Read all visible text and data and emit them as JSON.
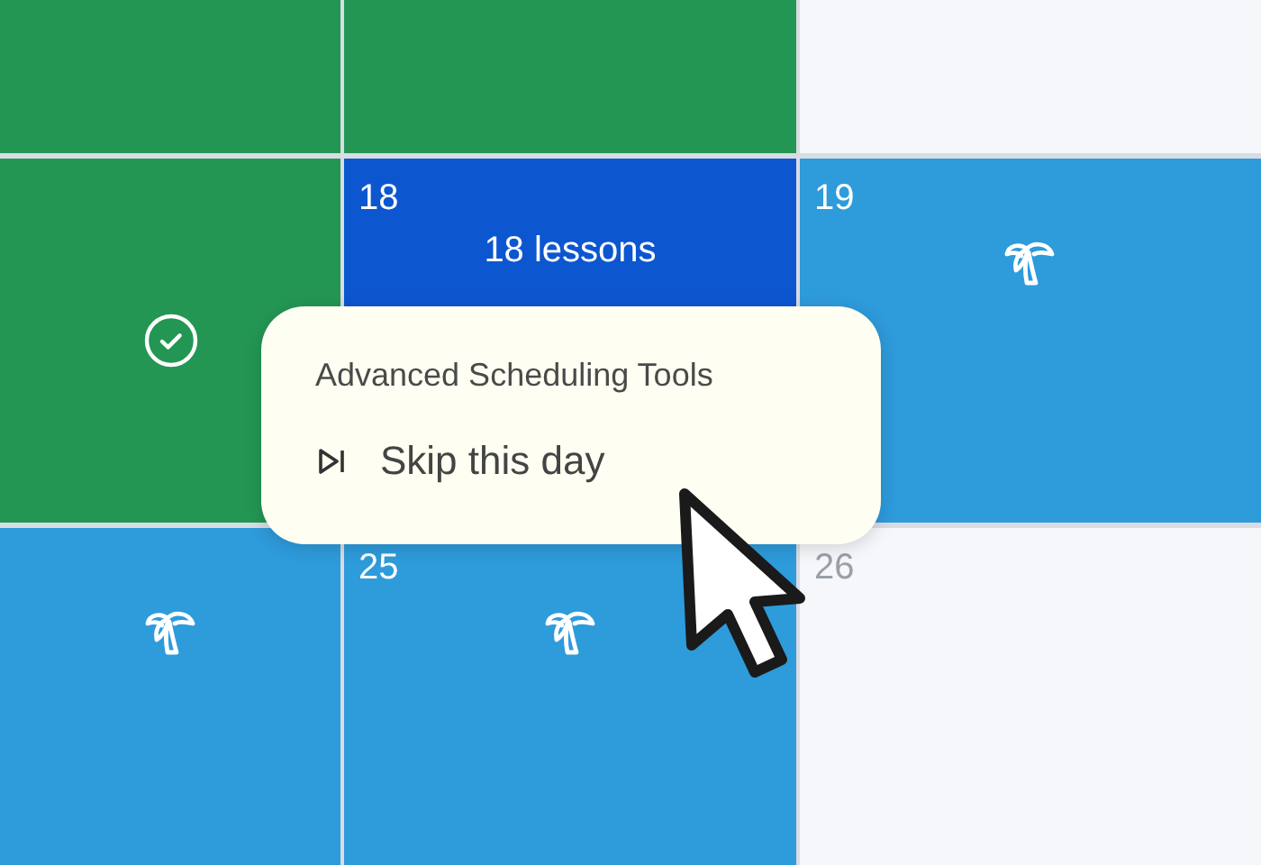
{
  "calendar": {
    "cells": [
      {
        "kind": "done"
      },
      {
        "kind": "done"
      },
      {
        "kind": "empty"
      },
      {
        "kind": "done",
        "checked": true
      },
      {
        "kind": "lessons",
        "date": "18",
        "label": "18 lessons"
      },
      {
        "kind": "holiday",
        "date": "19"
      },
      {
        "kind": "holiday"
      },
      {
        "kind": "holiday",
        "date": "25"
      },
      {
        "kind": "empty",
        "date": "26"
      }
    ]
  },
  "context_menu": {
    "title": "Advanced Scheduling Tools",
    "items": [
      {
        "label": "Skip this day"
      }
    ]
  }
}
